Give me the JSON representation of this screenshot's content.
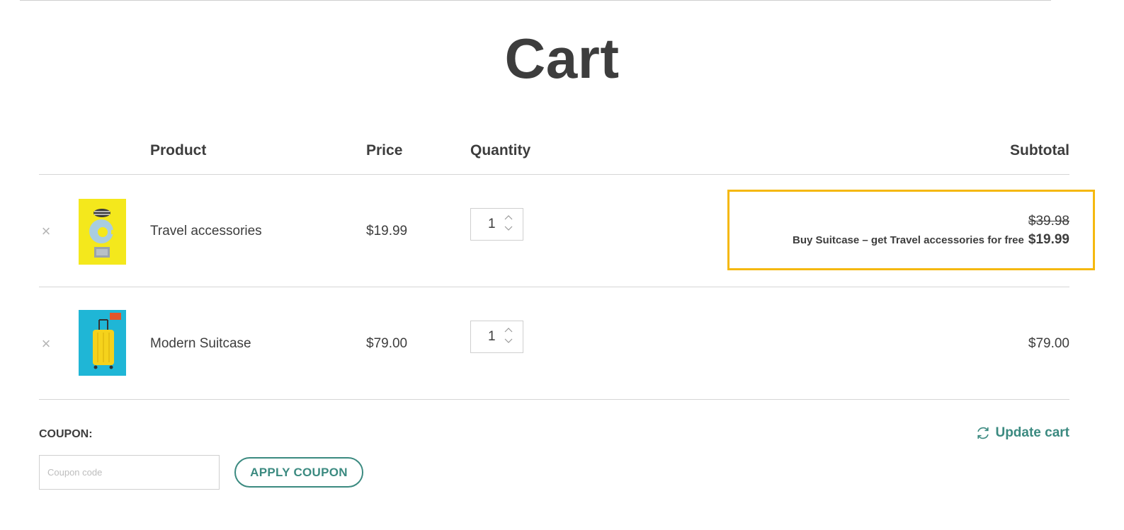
{
  "page_title": "Cart",
  "table_headers": {
    "product": "Product",
    "price": "Price",
    "quantity": "Quantity",
    "subtotal": "Subtotal"
  },
  "items": [
    {
      "remove_icon": "×",
      "thumbnail_icon": "travel-accessories-image",
      "name": "Travel accessories",
      "price": "$19.99",
      "quantity": "1",
      "subtotal_original": "$39.98",
      "deal_text": "Buy Suitcase – get Travel accessories for free",
      "subtotal": "$19.99"
    },
    {
      "remove_icon": "×",
      "thumbnail_icon": "modern-suitcase-image",
      "name": "Modern Suitcase",
      "price": "$79.00",
      "quantity": "1",
      "subtotal": "$79.00"
    }
  ],
  "coupon": {
    "label": "COUPON:",
    "placeholder": "Coupon code",
    "apply_label": "APPLY COUPON"
  },
  "update_cart_label": "Update cart",
  "colors": {
    "accent": "#3b8a80",
    "highlight": "#f5b80f",
    "text": "#3d3d3d"
  }
}
